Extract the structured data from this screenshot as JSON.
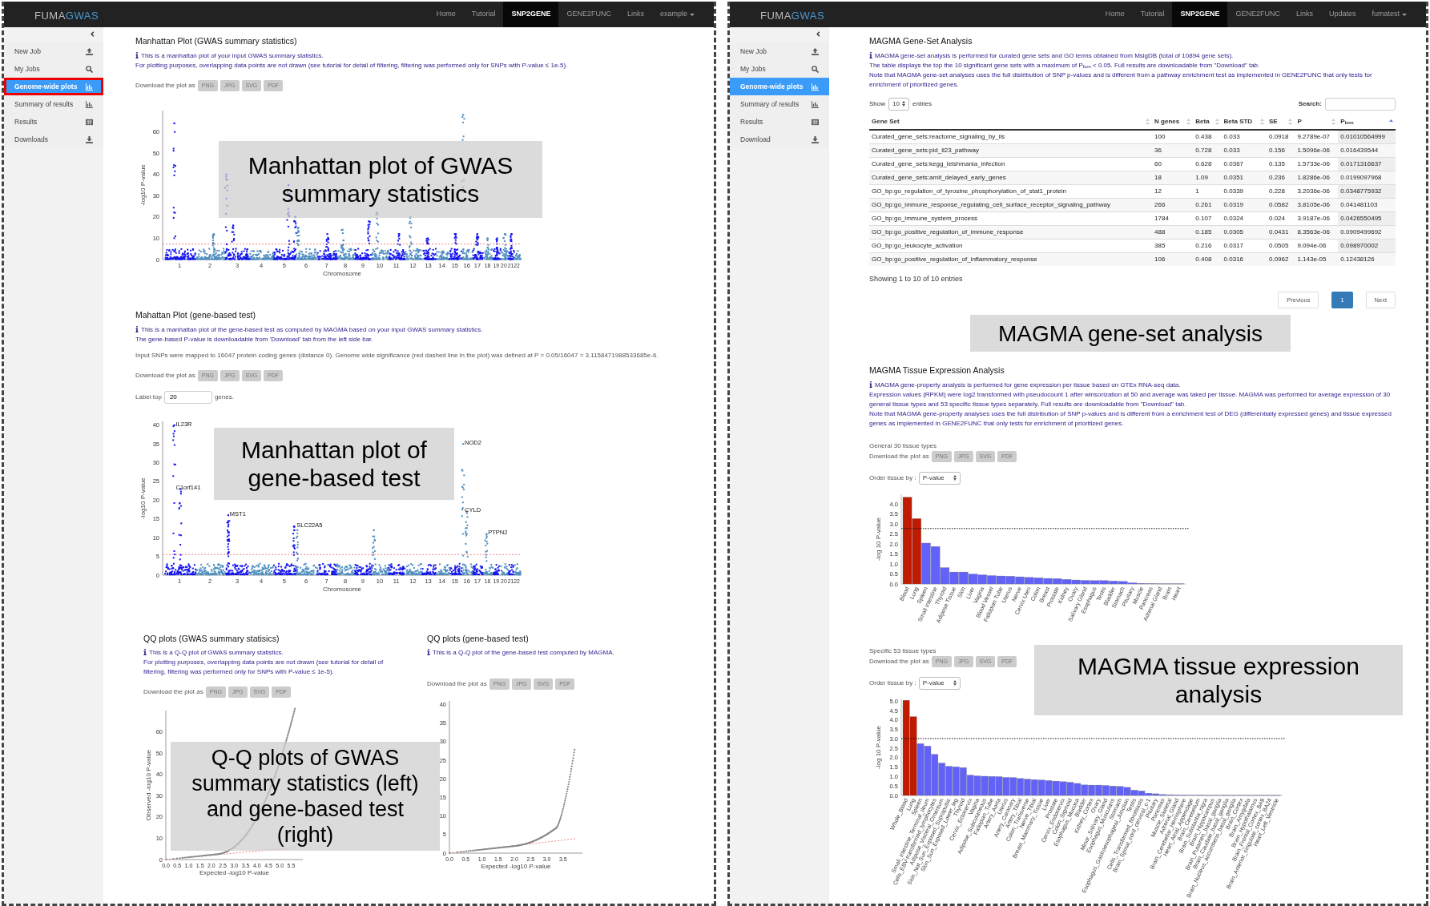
{
  "left_screen": {
    "navbar": {
      "brand_main": "FUMA",
      "brand_accent": "GWAS",
      "items": [
        {
          "label": "Home",
          "selected": false,
          "kind": "link"
        },
        {
          "label": "Tutorial",
          "selected": false,
          "kind": "link"
        },
        {
          "label": "SNP2GENE",
          "selected": true,
          "kind": "link"
        },
        {
          "label": "GENE2FUNC",
          "selected": false,
          "kind": "link"
        },
        {
          "label": "Links",
          "selected": false,
          "kind": "link"
        },
        {
          "label": "example",
          "selected": false,
          "kind": "dropdown"
        }
      ]
    },
    "sidebar": {
      "items": [
        {
          "label": "New Job",
          "selected": false,
          "outlined": false
        },
        {
          "label": "My Jobs",
          "selected": false,
          "outlined": false
        },
        {
          "label": "Genome-wide plots",
          "selected": true,
          "outlined": true
        },
        {
          "label": "Summary of results",
          "selected": false,
          "outlined": false
        },
        {
          "label": "Results",
          "selected": false,
          "outlined": false
        },
        {
          "label": "Downloads",
          "selected": false,
          "outlined": false
        }
      ]
    },
    "manhattan_gwas": {
      "title": "Manhattan Plot (GWAS summary statistics)",
      "info": [
        "This is a manhattan plot of your input GWAS summary statistics.",
        "For plotting purposes, overlapping data points are not drawn (see tutorial for detail of filtering, filtering was performed only for SNPs with P-value ≤ 1e-5)."
      ],
      "download_label": "Download the plot as",
      "download_buttons": [
        "PNG",
        "JPG",
        "SVG",
        "PDF"
      ],
      "plot": {
        "ylabel": "-log10 P-value",
        "xlabel": "Chromosome",
        "yticks": [
          "60",
          "50",
          "40",
          "30",
          "20",
          "10",
          "0"
        ],
        "xticks": [
          "1",
          "2",
          "3",
          "4",
          "5",
          "6",
          "7",
          "8",
          "9",
          "10",
          "11",
          "12",
          "13",
          "14",
          "15",
          "16",
          "17",
          "18",
          "19",
          "20",
          "21",
          "22"
        ]
      }
    },
    "manhattan_gene": {
      "title": "Mahattan Plot (gene-based test)",
      "info": [
        "This is a manhattan plot of the gene-based test as computed by MAGMA based on your input GWAS summary statistics.",
        "The gene-based P-value is downloadable from 'Download' tab from the left side bar."
      ],
      "note": "Input SNPs were mapped to 16047 protein coding genes (distance 0). Genome wide significance (red dashed line in the plot) was defined at P = 0.05/16047 = 3.1158471988533685e-6.",
      "download_label": "Download the plot as",
      "download_buttons": [
        "PNG",
        "JPG",
        "SVG",
        "PDF"
      ],
      "label_top": {
        "label": "Label top",
        "value": "20",
        "suffix": "genes."
      },
      "plot": {
        "ylabel": "-log10 P-value",
        "xlabel": "Chromosome",
        "yticks": [
          "40",
          "35",
          "30",
          "25",
          "20",
          "15",
          "10",
          "5",
          "0"
        ],
        "xticks": [
          "1",
          "2",
          "3",
          "4",
          "5",
          "6",
          "7",
          "8",
          "9",
          "10",
          "11",
          "12",
          "13",
          "14",
          "15",
          "16",
          "17",
          "18",
          "19",
          "20",
          "21",
          "22"
        ],
        "gene_labels": [
          "IL23R",
          "C1orf141",
          "MST1",
          "SLC22A5",
          "NOD2",
          "CYLD",
          "PTPN2"
        ]
      }
    },
    "qq_gwas": {
      "title": "QQ plots (GWAS summary statisics)",
      "info": [
        "This is a Q-Q plot of GWAS summary statistics.",
        "For plotting purposes, overlapping data points are not drawn (see tutorial for detail of filtering, filtering was performed only for SNPs with P-value ≤ 1e-5)."
      ],
      "download_label": "Download the plot as",
      "download_buttons": [
        "PNG",
        "JPG",
        "SVG",
        "PDF"
      ],
      "plot": {
        "ylabel": "Observed -log10 P-value",
        "xlabel": "Expected -log10 P-value",
        "yticks": [
          "60",
          "50",
          "40",
          "30",
          "20",
          "10",
          "0"
        ],
        "xticks": [
          "0.0",
          "0.5",
          "1.0",
          "1.5",
          "2.0",
          "2.5",
          "3.0",
          "3.5",
          "4.0",
          "4.5",
          "5.0",
          "5.5"
        ]
      }
    },
    "qq_gene": {
      "title": "QQ plots (gene-based test)",
      "info": [
        "This is a Q-Q plot of the gene-based test computed by MAGMA."
      ],
      "download_label": "Download the plot as",
      "download_buttons": [
        "PNG",
        "JPG",
        "SVG",
        "PDF"
      ],
      "plot": {
        "xlabel": "Expected -log10 P-value",
        "yticks": [
          "40",
          "35",
          "30",
          "25",
          "20",
          "15",
          "10",
          "5",
          "0"
        ],
        "xticks": [
          "0.0",
          "0.5",
          "1.0",
          "1.5",
          "2.0",
          "2.5",
          "3.0",
          "3.5"
        ]
      }
    },
    "callouts": [
      "Manhattan plot of GWAS summary statistics",
      "Manhattan plot of gene-based test",
      "Q-Q plots of GWAS summary statistics (left) and gene-based test (right)"
    ]
  },
  "right_screen": {
    "navbar": {
      "brand_main": "FUMA",
      "brand_accent": "GWAS",
      "items": [
        {
          "label": "Home",
          "selected": false,
          "kind": "link"
        },
        {
          "label": "Tutorial",
          "selected": false,
          "kind": "link"
        },
        {
          "label": "SNP2GENE",
          "selected": true,
          "kind": "link"
        },
        {
          "label": "GENE2FUNC",
          "selected": false,
          "kind": "link"
        },
        {
          "label": "Links",
          "selected": false,
          "kind": "link"
        },
        {
          "label": "Updates",
          "selected": false,
          "kind": "link"
        },
        {
          "label": "fumatest",
          "selected": false,
          "kind": "dropdown"
        }
      ]
    },
    "sidebar": {
      "items": [
        {
          "label": "New Job",
          "selected": false,
          "outlined": false
        },
        {
          "label": "My Jobs",
          "selected": false,
          "outlined": false
        },
        {
          "label": "Genome-wide plots",
          "selected": true,
          "outlined": false
        },
        {
          "label": "Summary of results",
          "selected": false,
          "outlined": false
        },
        {
          "label": "Results",
          "selected": false,
          "outlined": false
        },
        {
          "label": "Download",
          "selected": false,
          "outlined": false
        }
      ]
    },
    "gene_set": {
      "title": "MAGMA Gene-Set Analysis",
      "info": [
        "MAGMA gene-set analysis is performed for curated gene sets and GO terms obtained from MsigDB (total of 10894 gene sets).",
        "The table displays the top the 10 significant gene sets with a maximum of P$_{bon}$ < 0.05. Full results are downloadable from \"Download\" tab.",
        "Note that MAGMA gene-set analyses uses the full distribution of SNP p-values and is different from a pathway enrichment test as implemented in GENE2FUNC that only tests for enrichment of prioritized genes."
      ],
      "show_label": "Show",
      "page_size": "10",
      "entries_label": "entries",
      "search_label": "Search:",
      "table": {
        "columns": [
          {
            "label": "Gene Set",
            "sorted": false
          },
          {
            "label": "N genes",
            "sorted": false
          },
          {
            "label": "Beta",
            "sorted": false
          },
          {
            "label": "Beta STD",
            "sorted": false
          },
          {
            "label": "SE",
            "sorted": false
          },
          {
            "label": "P",
            "sorted": false
          },
          {
            "label": "P$_{bon}$",
            "sorted": true
          }
        ],
        "rows": [
          [
            "Curated_gene_sets:reactome_signaling_by_ils",
            "100",
            "0.438",
            "0.033",
            "0.0918",
            "9.2789e-07",
            "0.01010564999"
          ],
          [
            "Curated_gene_sets:pid_il23_pathway",
            "36",
            "0.728",
            "0.033",
            "0.156",
            "1.5096e-06",
            "0.016439544"
          ],
          [
            "Curated_gene_sets:kegg_leishmania_infection",
            "60",
            "0.628",
            "0.0367",
            "0.135",
            "1.5733e-06",
            "0.0171316637"
          ],
          [
            "Curated_gene_sets:amit_delayed_early_genes",
            "18",
            "1.09",
            "0.0351",
            "0.236",
            "1.8286e-06",
            "0.0199097968"
          ],
          [
            "GO_bp:go_regulation_of_tyrosine_phosphorylation_of_stat1_protein",
            "12",
            "1",
            "0.0339",
            "0.228",
            "3.2036e-06",
            "0.0348775932"
          ],
          [
            "GO_bp:go_immune_response_regulating_cell_surface_receptor_signaling_pathway",
            "266",
            "0.261",
            "0.0319",
            "0.0582",
            "3.8105e-06",
            "0.041481103"
          ],
          [
            "GO_bp:go_immune_system_process",
            "1784",
            "0.107",
            "0.0324",
            "0.024",
            "3.9187e-06",
            "0.0426550495"
          ],
          [
            "GO_bp:go_positive_regulation_of_immune_response",
            "488",
            "0.185",
            "0.0305",
            "0.0431",
            "8.3563e-06",
            "0.0909499692"
          ],
          [
            "GO_bp:go_leukocyte_activation",
            "385",
            "0.216",
            "0.0317",
            "0.0505",
            "9.094e-06",
            "0.098970002"
          ],
          [
            "GO_bp:go_positive_regulation_of_inflammatory_response",
            "106",
            "0.408",
            "0.0316",
            "0.0962",
            "1.143e-05",
            "0.12438126"
          ]
        ]
      },
      "footer": "Showing 1 to 10 of 10 entries",
      "pagination": [
        {
          "label": "Previous",
          "selected": false
        },
        {
          "label": "1",
          "selected": true
        },
        {
          "label": "Next",
          "selected": false
        }
      ]
    },
    "tissue": {
      "title": "MAGMA Tissue Expression Analysis",
      "info": [
        "MAGMA gene-property analysis is performed for gene expression per tissue based on GTEx RNA-seq data.",
        "Expression values (RPKM) were log2 transformed with pseudocount 1 after winsorization at 50 and average was taked per tissue. MAGMA was performed for average expression of 30 general tissue types and 53 specific tissue types separately. Full results are downloadable from \"Download\" tab.",
        "Note that MAGMA gene-property analyses uses the full distribution of SNP p-values and is different from a enrichment test of DEG (differentially expressed genes) and tissue expressed genes as implemented in GENE2FUNC that only tests for enrichment of prioritized genes."
      ],
      "panels": [
        {
          "heading": "General 30 tissue types",
          "download_label": "Download the plot as",
          "download_buttons": [
            "PNG",
            "JPG",
            "SVG",
            "PDF"
          ],
          "order_label": "Order tissue by :",
          "order_value": "P-value",
          "chart_data": {
            "type": "bar",
            "ylabel": "-log 10 P-value",
            "stacked": true,
            "categories": [
              "Blood",
              "Lung",
              "Spleen",
              "Small Intestine",
              "Thyroid",
              "Adipose Tissue",
              "Skin",
              "Liver",
              "Vagina",
              "Blood Vessel",
              "Fallopian Tube",
              "Uterus",
              "Nerve",
              "Cervix Uteri",
              "Colon",
              "Breast",
              "Prostate",
              "Kidney",
              "Ovary",
              "Salivary Gland",
              "Esophagus",
              "Testis",
              "Bladder",
              "Stomach",
              "Pituitary",
              "Muscle",
              "Pancreas",
              "Adrenal Gland",
              "Brain",
              "Heart"
            ],
            "series": [
              {
                "color": "#c01a00",
                "values": [
                  4.35,
                  3.28,
                  null,
                  null,
                  null,
                  null,
                  null,
                  null,
                  null,
                  null,
                  null,
                  null,
                  null,
                  null,
                  null,
                  null,
                  null,
                  null,
                  null,
                  null,
                  null,
                  null,
                  null,
                  null,
                  null,
                  null,
                  null,
                  null,
                  null,
                  null
                ]
              },
              {
                "color": "#6262f8",
                "values": [
                  null,
                  null,
                  2.05,
                  1.88,
                  0.82,
                  0.6,
                  0.6,
                  0.5,
                  0.46,
                  0.42,
                  0.4,
                  0.39,
                  0.36,
                  0.33,
                  0.31,
                  0.28,
                  0.27,
                  0.23,
                  0.2,
                  0.18,
                  0.17,
                  0.17,
                  0.15,
                  0.13,
                  0.06,
                  0.03,
                  0.02,
                  0.01,
                  0.01,
                  0.01
                ]
              }
            ],
            "ylim": [
              0,
              4.5
            ],
            "ref_lines": [
              {
                "axis": "y",
                "value": 2.78
              }
            ],
            "yticks": [
              {
                "value": 4,
                "label": "4.0"
              },
              {
                "value": 3.5,
                "label": "3.5"
              },
              {
                "value": 3,
                "label": "3.0"
              },
              {
                "value": 2.5,
                "label": "2.5"
              },
              {
                "value": 2,
                "label": "2.0"
              },
              {
                "value": 1.5,
                "label": "1.5"
              },
              {
                "value": 1,
                "label": "1.0"
              },
              {
                "value": 0.5,
                "label": "0.5"
              },
              {
                "value": 0,
                "label": "0.0"
              }
            ]
          }
        },
        {
          "heading": "Specific 53 tissue types",
          "download_label": "Download the plot as",
          "download_buttons": [
            "PNG",
            "JPG",
            "SVG",
            "PDF"
          ],
          "order_label": "Order tissue by :",
          "order_value": "P-value",
          "chart_data": {
            "type": "bar",
            "ylabel": "-log 10 P-value",
            "stacked": true,
            "categories": [
              "Whole_Blood",
              "Lung",
              "Spleen",
              "Small_Intestine_Terminal_Ileum",
              "Cells_EBV-transformed_lymphocytes",
              "Adipose_Visceral_Omentum",
              "Skin_Not_Sun_Exposed_Suprapubic",
              "Skin_Sun_Exposed_Lower_leg",
              "Thyroid",
              "Cervix_Ectocervix",
              "Vagina",
              "Adipose_Subcutaneous",
              "Fallopian_Tube",
              "Artery_Aorta",
              "Uterus",
              "Artery_Coronary",
              "Artery_Tibial",
              "Colon_Transverse",
              "Nerve_Tibial",
              "Breast_Mammary_Tissue",
              "Liver",
              "Prostate",
              "Cervix_Endocervix",
              "Colon_Sigmoid",
              "Esophagus_Mucosa",
              "Bladder",
              "Kidney_Cortex",
              "Ovary",
              "Minor_Salivary_Gland",
              "Esophagus_Muscularis",
              "Stomach",
              "Esophagus_Gastroesophageal_Junction",
              "Testis",
              "Cells_Transformed_fibroblasts",
              "Brain_Spinal_cord_cervical_c-1",
              "Pituitary",
              "Pancreas",
              "Muscle_Skeletal",
              "Adrenal_Gland",
              "Brain_Cerebellar_Hemisphere",
              "Heart_Atrial_Appendage",
              "Brain_Cerebellum",
              "Brain_Substantia_nigra",
              "Brain_Hippocampus",
              "Brain_Putamen_basal_ganglia",
              "Brain_Caudate_basal_ganglia",
              "Brain_Nucleus_accumbens_basal_ganglia",
              "Brain_Cortex",
              "Brain_Amygdala",
              "Brain_Hypothalamus",
              "Brain_Frontal_Cortex_BA9",
              "Brain_Anterior_cingulate_cortex_BA24",
              "Heart_Left_Ventricle"
            ],
            "series": [
              {
                "color": "#c01a00",
                "values": [
                  5.05,
                  4.18,
                  null,
                  null,
                  null,
                  null,
                  null,
                  null,
                  null,
                  null,
                  null,
                  null,
                  null,
                  null,
                  null,
                  null,
                  null,
                  null,
                  null,
                  null,
                  null,
                  null,
                  null,
                  null,
                  null,
                  null,
                  null,
                  null,
                  null,
                  null,
                  null,
                  null,
                  null,
                  null,
                  null,
                  null,
                  null,
                  null,
                  null,
                  null,
                  null,
                  null,
                  null,
                  null,
                  null,
                  null,
                  null,
                  null,
                  null,
                  null,
                  null,
                  null,
                  null
                ]
              },
              {
                "color": "#6262f8",
                "values": [
                  null,
                  null,
                  2.75,
                  2.62,
                  2.18,
                  1.72,
                  1.55,
                  1.52,
                  1.48,
                  1.08,
                  1.04,
                  1.02,
                  1.01,
                  1.0,
                  0.96,
                  0.95,
                  0.9,
                  0.87,
                  0.84,
                  0.82,
                  0.79,
                  0.76,
                  0.73,
                  0.7,
                  0.64,
                  0.56,
                  0.55,
                  0.55,
                  0.53,
                  0.5,
                  0.48,
                  0.43,
                  0.28,
                  0.24,
                  0.12,
                  0.09,
                  0.05,
                  0.04,
                  0.03,
                  0.03,
                  0.02,
                  0.02,
                  0.01,
                  0.01,
                  0.01,
                  0.01,
                  0.01,
                  0.01,
                  0.01,
                  0.01,
                  0.01,
                  0.01,
                  0.01
                ]
              }
            ],
            "ylim": [
              0,
              5.1
            ],
            "ref_lines": [
              {
                "axis": "y",
                "value": 3.02
              }
            ],
            "yticks": [
              {
                "value": 5,
                "label": "5.0"
              },
              {
                "value": 4.5,
                "label": "4.5"
              },
              {
                "value": 4,
                "label": "4.0"
              },
              {
                "value": 3.5,
                "label": "3.5"
              },
              {
                "value": 3,
                "label": "3.0"
              },
              {
                "value": 2.5,
                "label": "2.5"
              },
              {
                "value": 2,
                "label": "2.0"
              },
              {
                "value": 1.5,
                "label": "1.5"
              },
              {
                "value": 1,
                "label": "1.0"
              },
              {
                "value": 0.5,
                "label": "0.5"
              },
              {
                "value": 0,
                "label": "0.0"
              }
            ]
          }
        }
      ]
    },
    "callouts": [
      "MAGMA gene-set analysis",
      "MAGMA tissue expression analysis"
    ]
  }
}
